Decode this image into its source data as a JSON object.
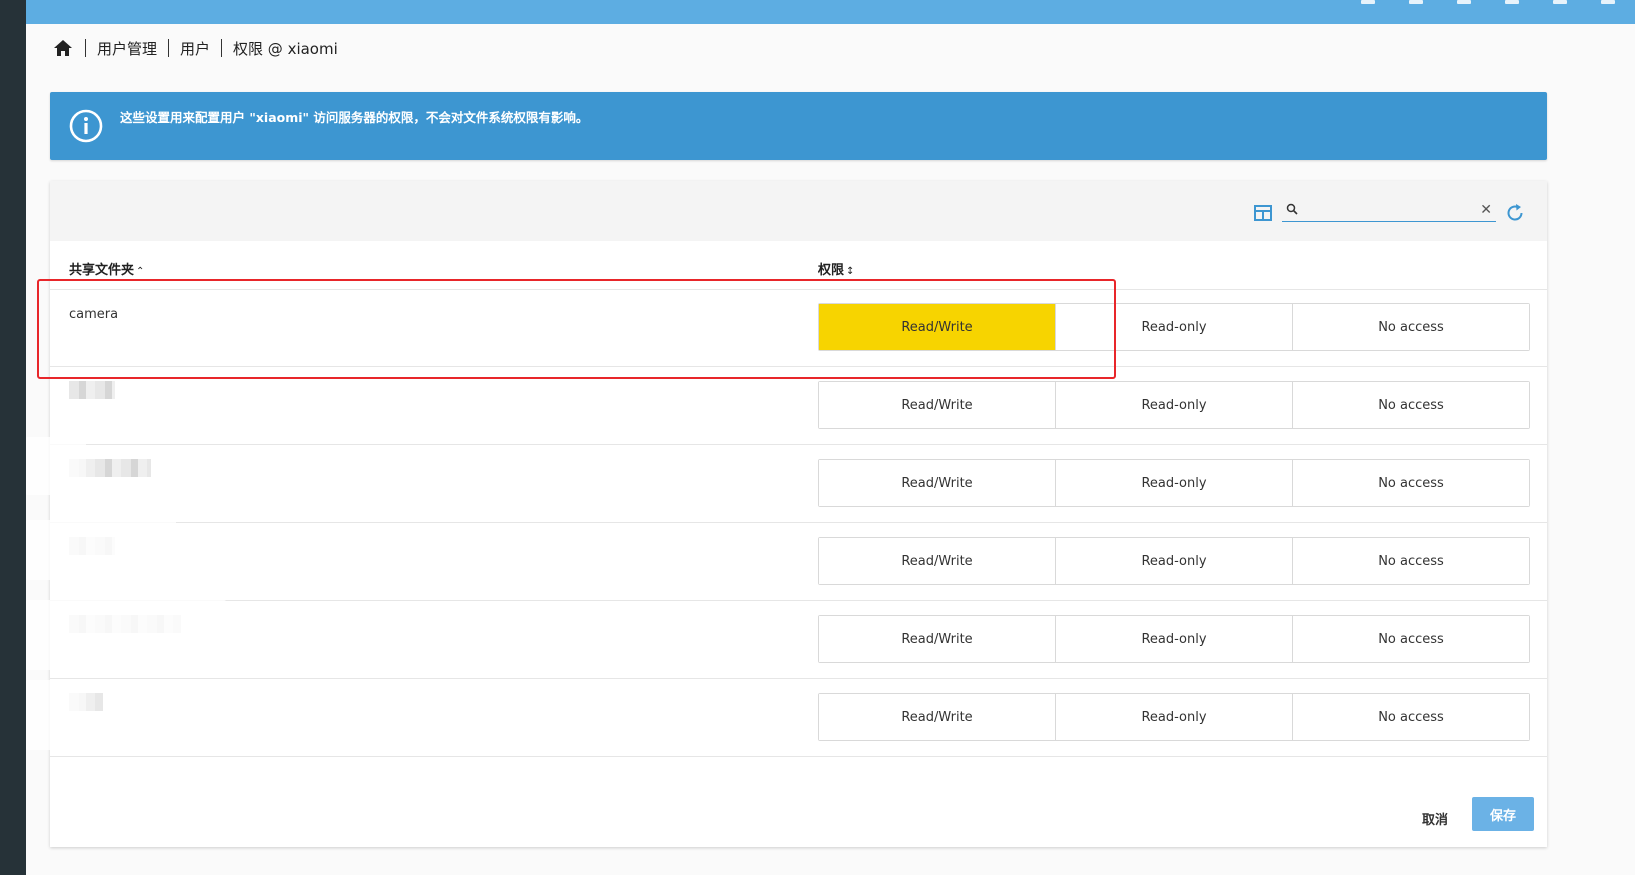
{
  "breadcrumb": {
    "home_icon": "home-icon",
    "items": [
      "用户管理",
      "用户",
      "权限 @ xiaomi"
    ]
  },
  "banner": {
    "icon": "info-icon",
    "text": "这些设置用来配置用户 \"xiaomi\" 访问服务器的权限，不会对文件系统权限有影响。",
    "color": "#3d96d1"
  },
  "toolbar": {
    "search": {
      "value": "",
      "placeholder": ""
    },
    "icons": [
      "table-view-icon",
      "search-icon",
      "clear-icon",
      "refresh-icon"
    ]
  },
  "table": {
    "headers": {
      "shared_folder": "共享文件夹",
      "permission": "权限"
    },
    "rows": [
      {
        "name": "camera",
        "selected": "Read/Write"
      },
      {
        "name": "",
        "selected": ""
      },
      {
        "name": "",
        "selected": ""
      },
      {
        "name": "",
        "selected": ""
      },
      {
        "name": "",
        "selected": ""
      },
      {
        "name": "",
        "selected": ""
      }
    ],
    "options": [
      "Read/Write",
      "Read-only",
      "No access"
    ]
  },
  "actions": {
    "cancel": "取消",
    "save": "保存"
  },
  "colors": {
    "selected": "#f7d400",
    "accent": "#3d96d1",
    "highlight": "#e8262a"
  }
}
